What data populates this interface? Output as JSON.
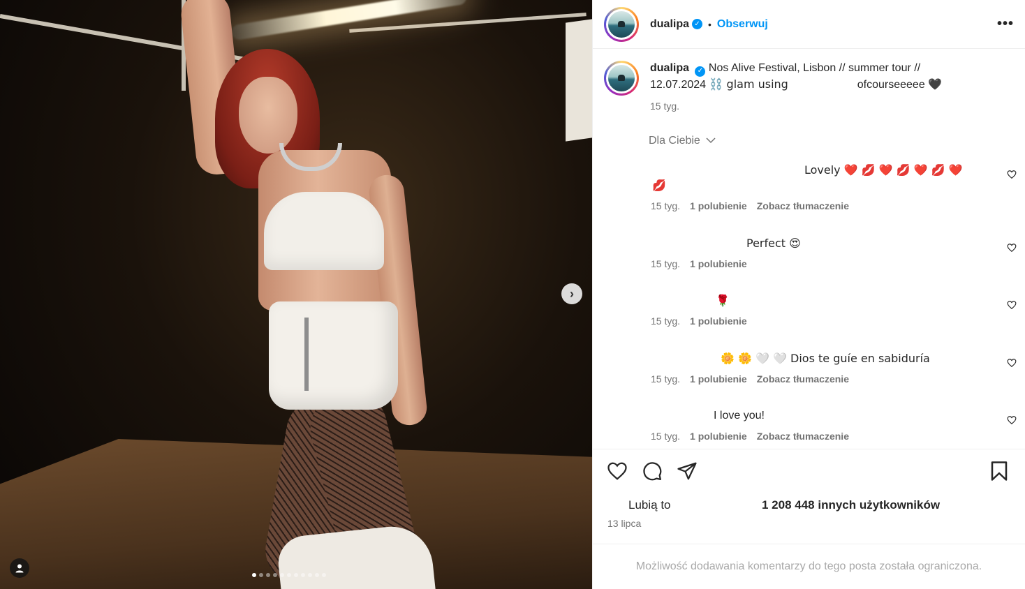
{
  "post": {
    "username": "dualipa",
    "follow_label": "Obserwuj",
    "separator": "•",
    "more_label": "•••"
  },
  "caption": {
    "username": "dualipa",
    "text_line1": "Nos Alive Festival, Lisbon // summer tour //",
    "text_line2_a": "12.07.2024",
    "text_line2_b": "⛓️ glam using",
    "text_line2_c": "ofcourseeeee",
    "text_line2_d": "🖤",
    "time": "15 tyg."
  },
  "comments_filter": "Dla Ciebie",
  "comments": [
    {
      "text": "Lovely ❤️ 💋 ❤️ 💋 ❤️ 💋 ❤️",
      "text_wrap": "💋",
      "time": "15 tyg.",
      "likes": "1 polubienie",
      "translate": "Zobacz tłumaczenie"
    },
    {
      "text": "Perfect 😍",
      "time": "15 tyg.",
      "likes": "1 polubienie"
    },
    {
      "text": "🌹",
      "time": "15 tyg.",
      "likes": "1 polubienie"
    },
    {
      "text": "🌼 🌼 🤍 🤍  Dios te guíe en sabiduría",
      "time": "15 tyg.",
      "likes": "1 polubienie",
      "translate": "Zobacz tłumaczenie"
    },
    {
      "text": "I love you!",
      "time": "15 tyg.",
      "likes": "1 polubienie",
      "translate": "Zobacz tłumaczenie"
    }
  ],
  "likes": {
    "label": "Lubią to",
    "count": "1 208 448 innych użytkowników"
  },
  "date": "13 lipca",
  "footer": "Możliwość dodawania komentarzy do tego posta została ograniczona.",
  "carousel": {
    "total": 11,
    "active": 1
  },
  "colors": {
    "accent": "#0095f6",
    "text": "#262626",
    "muted": "#737373"
  }
}
